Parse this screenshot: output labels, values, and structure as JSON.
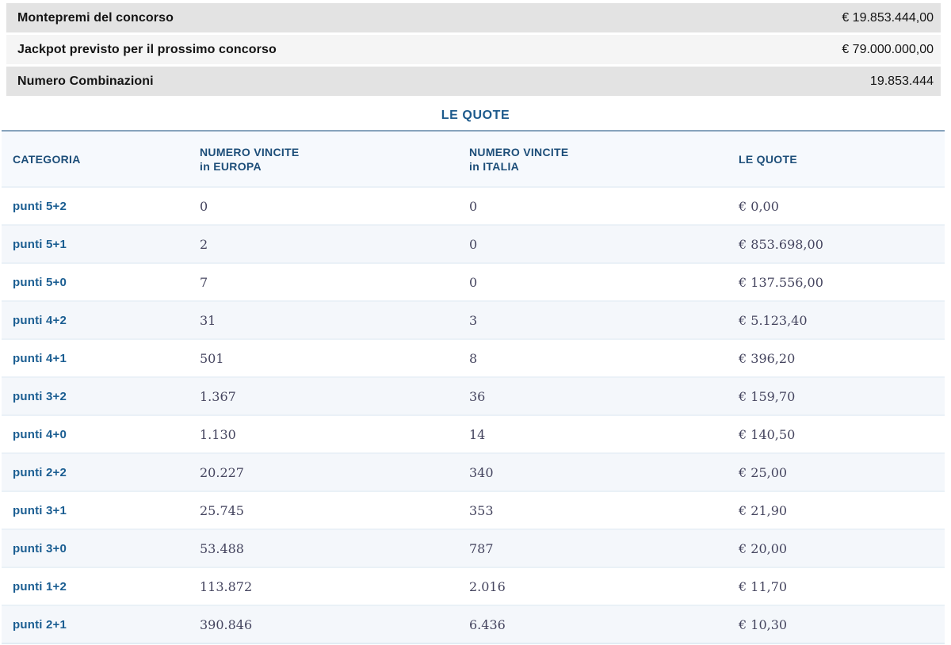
{
  "summary": {
    "rows": [
      {
        "label": "Montepremi del concorso",
        "value": "€ 19.853.444,00"
      },
      {
        "label": "Jackpot previsto per il prossimo concorso",
        "value": "€ 79.000.000,00"
      },
      {
        "label": "Numero Combinazioni",
        "value": "19.853.444"
      }
    ]
  },
  "section_title": "LE QUOTE",
  "quote_table": {
    "headers": {
      "categoria": "CATEGORIA",
      "europa_line1": "NUMERO VINCITE",
      "europa_line2": "in EUROPA",
      "italia_line1": "NUMERO VINCITE",
      "italia_line2": "in ITALIA",
      "quote": "LE QUOTE"
    },
    "rows": [
      {
        "categoria": "punti 5+2",
        "vincite_europa": "0",
        "vincite_italia": "0",
        "quota": "€ 0,00"
      },
      {
        "categoria": "punti 5+1",
        "vincite_europa": "2",
        "vincite_italia": "0",
        "quota": "€ 853.698,00"
      },
      {
        "categoria": "punti 5+0",
        "vincite_europa": "7",
        "vincite_italia": "0",
        "quota": "€ 137.556,00"
      },
      {
        "categoria": "punti 4+2",
        "vincite_europa": "31",
        "vincite_italia": "3",
        "quota": "€ 5.123,40"
      },
      {
        "categoria": "punti 4+1",
        "vincite_europa": "501",
        "vincite_italia": "8",
        "quota": "€ 396,20"
      },
      {
        "categoria": "punti 3+2",
        "vincite_europa": "1.367",
        "vincite_italia": "36",
        "quota": "€ 159,70"
      },
      {
        "categoria": "punti 4+0",
        "vincite_europa": "1.130",
        "vincite_italia": "14",
        "quota": "€ 140,50"
      },
      {
        "categoria": "punti 2+2",
        "vincite_europa": "20.227",
        "vincite_italia": "340",
        "quota": "€ 25,00"
      },
      {
        "categoria": "punti 3+1",
        "vincite_europa": "25.745",
        "vincite_italia": "353",
        "quota": "€ 21,90"
      },
      {
        "categoria": "punti 3+0",
        "vincite_europa": "53.488",
        "vincite_italia": "787",
        "quota": "€ 20,00"
      },
      {
        "categoria": "punti 1+2",
        "vincite_europa": "113.872",
        "vincite_italia": "2.016",
        "quota": "€ 11,70"
      },
      {
        "categoria": "punti 2+1",
        "vincite_europa": "390.846",
        "vincite_italia": "6.436",
        "quota": "€ 10,30"
      }
    ]
  },
  "colors": {
    "accent_blue": "#1b5e92",
    "header_blue": "#1d4e79",
    "title_blue": "#1d5a8c",
    "bar_gray_dark": "#e3e3e3",
    "bar_gray_light": "#f5f5f5",
    "row_alt_bg": "#f4f7fb",
    "serif_text": "#45455f",
    "header_border": "#87a3bc"
  }
}
